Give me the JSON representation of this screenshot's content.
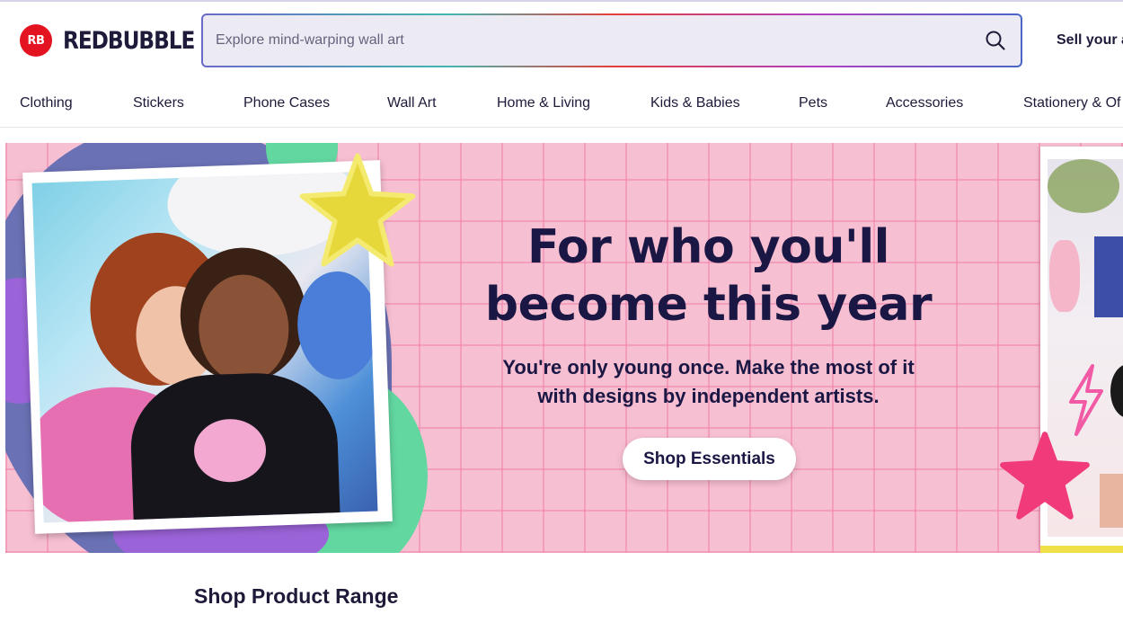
{
  "brand": {
    "logo_badge": "RB",
    "name": "REDBUBBLE",
    "color": "#e41321"
  },
  "search": {
    "placeholder": "Explore mind-warping wall art",
    "icon": "search-icon"
  },
  "header": {
    "sell_label": "Sell your a"
  },
  "nav": {
    "items": [
      {
        "label": "Clothing"
      },
      {
        "label": "Stickers"
      },
      {
        "label": "Phone Cases"
      },
      {
        "label": "Wall Art"
      },
      {
        "label": "Home & Living"
      },
      {
        "label": "Kids & Babies"
      },
      {
        "label": "Pets"
      },
      {
        "label": "Accessories"
      },
      {
        "label": "Stationery & Of"
      }
    ]
  },
  "hero": {
    "title_line1": "For who you'll",
    "title_line2": "become this year",
    "subtitle_line1": "You're only young once. Make the most of it",
    "subtitle_line2": "with designs by independent artists.",
    "cta_label": "Shop Essentials",
    "background_color": "#f7bfd2"
  },
  "sections": {
    "product_range_title": "Shop Product Range"
  }
}
